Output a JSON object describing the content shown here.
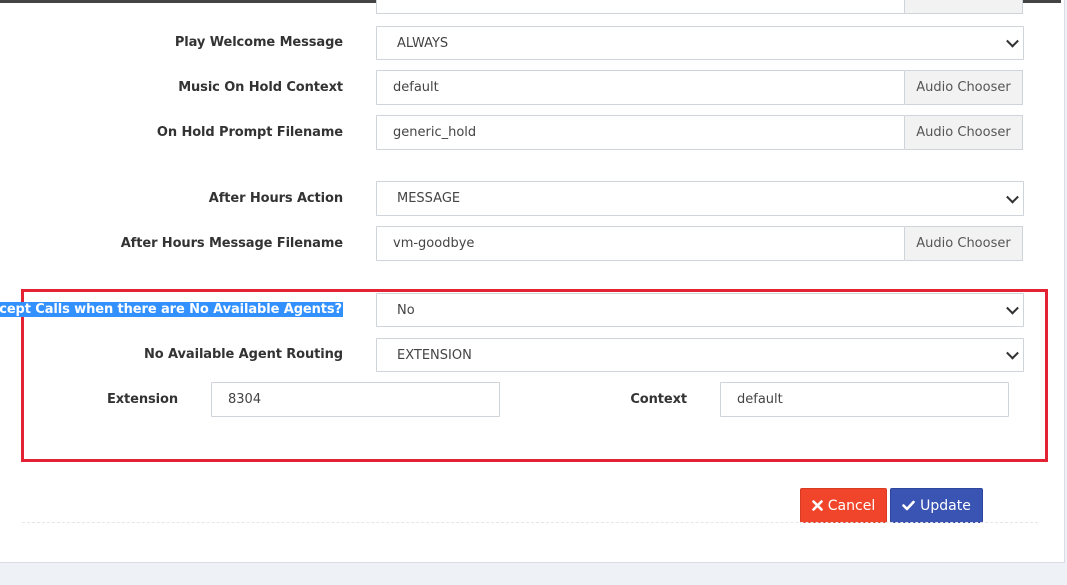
{
  "form": {
    "play_welcome": {
      "label": "Play Welcome Message",
      "value": "ALWAYS"
    },
    "moh_context": {
      "label": "Music On Hold Context",
      "value": "default",
      "chooser": "Audio Chooser"
    },
    "hold_prompt": {
      "label": "On Hold Prompt Filename",
      "value": "generic_hold",
      "chooser": "Audio Chooser"
    },
    "after_hours_action": {
      "label": "After Hours Action",
      "value": "MESSAGE"
    },
    "after_hours_message": {
      "label": "After Hours Message Filename",
      "value": "vm-goodbye",
      "chooser": "Audio Chooser"
    },
    "accept_calls": {
      "label": "Accept Calls when there are No Available Agents?",
      "value": "No"
    },
    "no_agent_routing": {
      "label": "No Available Agent Routing",
      "value": "EXTENSION"
    },
    "extension": {
      "label": "Extension",
      "value": "8304"
    },
    "context": {
      "label": "Context",
      "value": "default"
    }
  },
  "actions": {
    "cancel": "Cancel",
    "update": "Update"
  },
  "colors": {
    "highlight_border": "#e32333",
    "cancel_bg": "#f0452b",
    "update_bg": "#3a54b4",
    "selection_bg": "#3390ff"
  },
  "icons": {
    "cancel": "x-icon",
    "update": "check-icon"
  }
}
